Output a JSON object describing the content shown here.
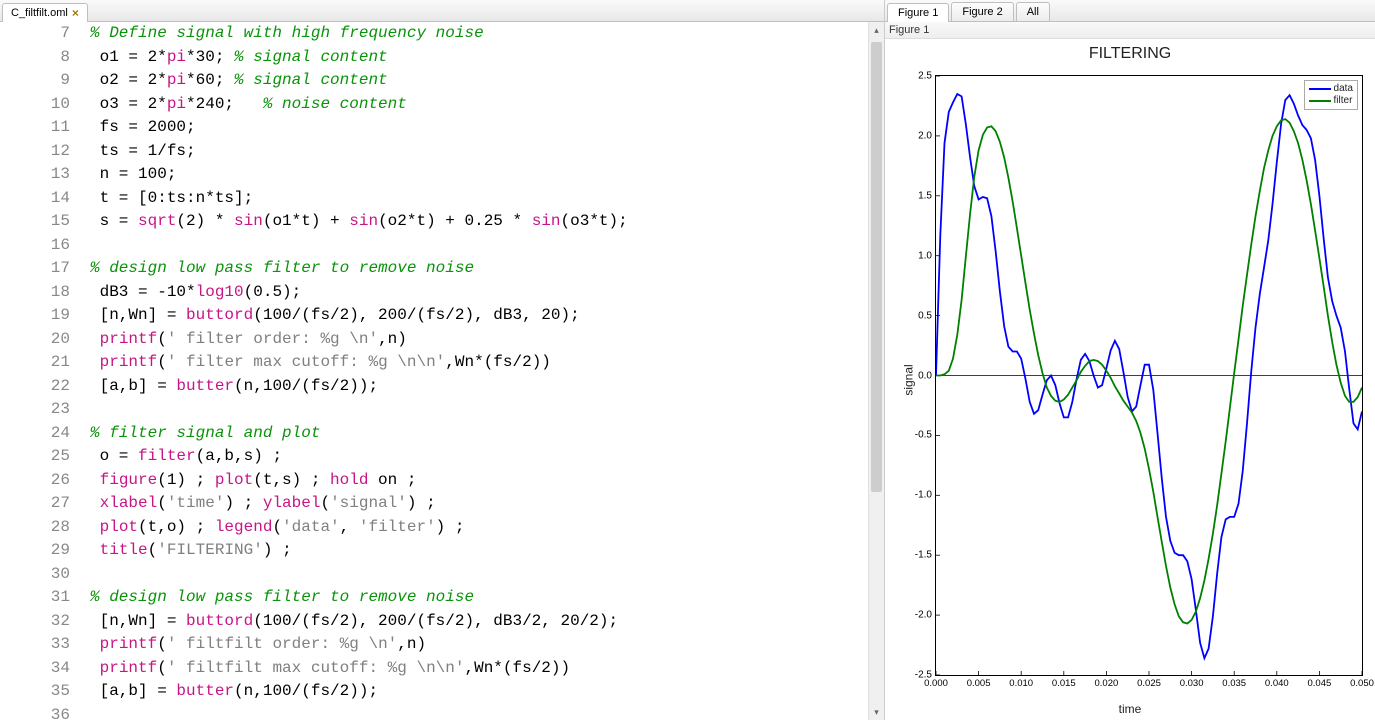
{
  "editor": {
    "tab_label": "C_filtfilt.oml",
    "lines": [
      {
        "n": 7,
        "tokens": [
          {
            "t": "% Define signal with high frequency noise",
            "c": "comment"
          }
        ]
      },
      {
        "n": 8,
        "tokens": [
          {
            "t": " o1 = 2*",
            "c": "default"
          },
          {
            "t": "pi",
            "c": "func"
          },
          {
            "t": "*30; ",
            "c": "default"
          },
          {
            "t": "% signal content",
            "c": "comment"
          }
        ]
      },
      {
        "n": 9,
        "tokens": [
          {
            "t": " o2 = 2*",
            "c": "default"
          },
          {
            "t": "pi",
            "c": "func"
          },
          {
            "t": "*60; ",
            "c": "default"
          },
          {
            "t": "% signal content",
            "c": "comment"
          }
        ]
      },
      {
        "n": 10,
        "tokens": [
          {
            "t": " o3 = 2*",
            "c": "default"
          },
          {
            "t": "pi",
            "c": "func"
          },
          {
            "t": "*240;   ",
            "c": "default"
          },
          {
            "t": "% noise content",
            "c": "comment"
          }
        ]
      },
      {
        "n": 11,
        "tokens": [
          {
            "t": " fs = 2000;",
            "c": "default"
          }
        ]
      },
      {
        "n": 12,
        "tokens": [
          {
            "t": " ts = 1/fs;",
            "c": "default"
          }
        ]
      },
      {
        "n": 13,
        "tokens": [
          {
            "t": " n = 100;",
            "c": "default"
          }
        ]
      },
      {
        "n": 14,
        "tokens": [
          {
            "t": " t = [0:ts:n*ts];",
            "c": "default"
          }
        ]
      },
      {
        "n": 15,
        "tokens": [
          {
            "t": " s = ",
            "c": "default"
          },
          {
            "t": "sqrt",
            "c": "func"
          },
          {
            "t": "(2) * ",
            "c": "default"
          },
          {
            "t": "sin",
            "c": "func"
          },
          {
            "t": "(o1*t) + ",
            "c": "default"
          },
          {
            "t": "sin",
            "c": "func"
          },
          {
            "t": "(o2*t) + 0.25 * ",
            "c": "default"
          },
          {
            "t": "sin",
            "c": "func"
          },
          {
            "t": "(o3*t);",
            "c": "default"
          }
        ]
      },
      {
        "n": 16,
        "tokens": []
      },
      {
        "n": 17,
        "tokens": [
          {
            "t": "% design low pass filter to remove noise",
            "c": "comment"
          }
        ]
      },
      {
        "n": 18,
        "tokens": [
          {
            "t": " dB3 = -10*",
            "c": "default"
          },
          {
            "t": "log10",
            "c": "func"
          },
          {
            "t": "(0.5);",
            "c": "default"
          }
        ]
      },
      {
        "n": 19,
        "tokens": [
          {
            "t": " [n,Wn] = ",
            "c": "default"
          },
          {
            "t": "buttord",
            "c": "func"
          },
          {
            "t": "(100/(fs/2), 200/(fs/2), dB3, 20);",
            "c": "default"
          }
        ]
      },
      {
        "n": 20,
        "tokens": [
          {
            "t": " ",
            "c": "default"
          },
          {
            "t": "printf",
            "c": "func"
          },
          {
            "t": "(",
            "c": "default"
          },
          {
            "t": "' filter order: %g \\n'",
            "c": "string"
          },
          {
            "t": ",n)",
            "c": "default"
          }
        ]
      },
      {
        "n": 21,
        "tokens": [
          {
            "t": " ",
            "c": "default"
          },
          {
            "t": "printf",
            "c": "func"
          },
          {
            "t": "(",
            "c": "default"
          },
          {
            "t": "' filter max cutoff: %g \\n\\n'",
            "c": "string"
          },
          {
            "t": ",Wn*(fs/2))",
            "c": "default"
          }
        ]
      },
      {
        "n": 22,
        "tokens": [
          {
            "t": " [a,b] = ",
            "c": "default"
          },
          {
            "t": "butter",
            "c": "func"
          },
          {
            "t": "(n,100/(fs/2));",
            "c": "default"
          }
        ]
      },
      {
        "n": 23,
        "tokens": []
      },
      {
        "n": 24,
        "tokens": [
          {
            "t": "% filter signal and plot",
            "c": "comment"
          }
        ]
      },
      {
        "n": 25,
        "tokens": [
          {
            "t": " o = ",
            "c": "default"
          },
          {
            "t": "filter",
            "c": "func"
          },
          {
            "t": "(a,b,s) ;",
            "c": "default"
          }
        ]
      },
      {
        "n": 26,
        "tokens": [
          {
            "t": " ",
            "c": "default"
          },
          {
            "t": "figure",
            "c": "func"
          },
          {
            "t": "(1) ; ",
            "c": "default"
          },
          {
            "t": "plot",
            "c": "func"
          },
          {
            "t": "(t,s) ; ",
            "c": "default"
          },
          {
            "t": "hold",
            "c": "func"
          },
          {
            "t": " on ;",
            "c": "default"
          }
        ]
      },
      {
        "n": 27,
        "tokens": [
          {
            "t": " ",
            "c": "default"
          },
          {
            "t": "xlabel",
            "c": "func"
          },
          {
            "t": "(",
            "c": "default"
          },
          {
            "t": "'time'",
            "c": "string"
          },
          {
            "t": ") ; ",
            "c": "default"
          },
          {
            "t": "ylabel",
            "c": "func"
          },
          {
            "t": "(",
            "c": "default"
          },
          {
            "t": "'signal'",
            "c": "string"
          },
          {
            "t": ") ;",
            "c": "default"
          }
        ]
      },
      {
        "n": 28,
        "tokens": [
          {
            "t": " ",
            "c": "default"
          },
          {
            "t": "plot",
            "c": "func"
          },
          {
            "t": "(t,o) ; ",
            "c": "default"
          },
          {
            "t": "legend",
            "c": "func"
          },
          {
            "t": "(",
            "c": "default"
          },
          {
            "t": "'data'",
            "c": "string"
          },
          {
            "t": ", ",
            "c": "default"
          },
          {
            "t": "'filter'",
            "c": "string"
          },
          {
            "t": ") ;",
            "c": "default"
          }
        ]
      },
      {
        "n": 29,
        "tokens": [
          {
            "t": " ",
            "c": "default"
          },
          {
            "t": "title",
            "c": "func"
          },
          {
            "t": "(",
            "c": "default"
          },
          {
            "t": "'FILTERING'",
            "c": "string"
          },
          {
            "t": ") ;",
            "c": "default"
          }
        ]
      },
      {
        "n": 30,
        "tokens": []
      },
      {
        "n": 31,
        "tokens": [
          {
            "t": "% design low pass filter to remove noise",
            "c": "comment"
          }
        ]
      },
      {
        "n": 32,
        "tokens": [
          {
            "t": " [n,Wn] = ",
            "c": "default"
          },
          {
            "t": "buttord",
            "c": "func"
          },
          {
            "t": "(100/(fs/2), 200/(fs/2), dB3/2, 20/2);",
            "c": "default"
          }
        ]
      },
      {
        "n": 33,
        "tokens": [
          {
            "t": " ",
            "c": "default"
          },
          {
            "t": "printf",
            "c": "func"
          },
          {
            "t": "(",
            "c": "default"
          },
          {
            "t": "' filtfilt order: %g \\n'",
            "c": "string"
          },
          {
            "t": ",n)",
            "c": "default"
          }
        ]
      },
      {
        "n": 34,
        "tokens": [
          {
            "t": " ",
            "c": "default"
          },
          {
            "t": "printf",
            "c": "func"
          },
          {
            "t": "(",
            "c": "default"
          },
          {
            "t": "' filtfilt max cutoff: %g \\n\\n'",
            "c": "string"
          },
          {
            "t": ",Wn*(fs/2))",
            "c": "default"
          }
        ]
      },
      {
        "n": 35,
        "tokens": [
          {
            "t": " [a,b] = ",
            "c": "default"
          },
          {
            "t": "butter",
            "c": "func"
          },
          {
            "t": "(n,100/(fs/2));",
            "c": "default"
          }
        ]
      },
      {
        "n": 36,
        "tokens": []
      }
    ]
  },
  "figure_pane": {
    "tabs": [
      "Figure 1",
      "Figure 2",
      "All"
    ],
    "active_tab": 0,
    "subtitle": "Figure 1"
  },
  "chart_data": {
    "type": "line",
    "title": "FILTERING",
    "xlabel": "time",
    "ylabel": "signal",
    "xlim": [
      0.0,
      0.05
    ],
    "ylim": [
      -2.5,
      2.5
    ],
    "x_ticks": [
      "0.000",
      "0.005",
      "0.010",
      "0.015",
      "0.020",
      "0.025",
      "0.030",
      "0.035",
      "0.040",
      "0.045",
      "0.050"
    ],
    "y_ticks": [
      "2.5",
      "2.0",
      "1.5",
      "1.0",
      "0.5",
      "0.0",
      "-0.5",
      "-1.0",
      "-1.5",
      "-2.0",
      "-2.5"
    ],
    "legend": [
      "data",
      "filter"
    ],
    "colors": {
      "data": "#0000ff",
      "filter": "#008000"
    },
    "series": [
      {
        "name": "data",
        "x_step": 0.0005,
        "y": [
          0.0,
          1.17,
          1.94,
          2.2,
          2.28,
          2.35,
          2.33,
          2.1,
          1.82,
          1.58,
          1.47,
          1.49,
          1.48,
          1.33,
          1.04,
          0.7,
          0.41,
          0.24,
          0.2,
          0.2,
          0.14,
          -0.03,
          -0.22,
          -0.32,
          -0.29,
          -0.16,
          -0.04,
          0.0,
          -0.08,
          -0.23,
          -0.35,
          -0.35,
          -0.22,
          -0.03,
          0.13,
          0.18,
          0.12,
          0.0,
          -0.1,
          -0.08,
          0.06,
          0.21,
          0.29,
          0.22,
          0.03,
          -0.18,
          -0.3,
          -0.26,
          -0.08,
          0.09,
          0.09,
          -0.12,
          -0.48,
          -0.86,
          -1.18,
          -1.38,
          -1.48,
          -1.5,
          -1.5,
          -1.55,
          -1.7,
          -1.96,
          -2.23,
          -2.36,
          -2.28,
          -2.01,
          -1.65,
          -1.35,
          -1.2,
          -1.18,
          -1.18,
          -1.07,
          -0.8,
          -0.4,
          0.03,
          0.4,
          0.68,
          0.9,
          1.13,
          1.43,
          1.78,
          2.1,
          2.3,
          2.34,
          2.27,
          2.17,
          2.09,
          2.05,
          1.98,
          1.8,
          1.5,
          1.14,
          0.82,
          0.62,
          0.5,
          0.4,
          0.2,
          -0.11,
          -0.4,
          -0.45,
          -0.3
        ]
      },
      {
        "name": "filter",
        "x_step": 0.0005,
        "y": [
          0.0,
          0.0,
          0.01,
          0.04,
          0.14,
          0.34,
          0.63,
          0.99,
          1.35,
          1.66,
          1.88,
          2.01,
          2.07,
          2.08,
          2.04,
          1.95,
          1.82,
          1.65,
          1.45,
          1.23,
          1.0,
          0.77,
          0.55,
          0.35,
          0.17,
          0.02,
          -0.1,
          -0.17,
          -0.21,
          -0.22,
          -0.2,
          -0.16,
          -0.1,
          -0.04,
          0.03,
          0.08,
          0.12,
          0.13,
          0.12,
          0.09,
          0.04,
          -0.02,
          -0.09,
          -0.15,
          -0.21,
          -0.26,
          -0.31,
          -0.38,
          -0.48,
          -0.61,
          -0.78,
          -0.97,
          -1.18,
          -1.39,
          -1.59,
          -1.77,
          -1.91,
          -2.01,
          -2.06,
          -2.07,
          -2.04,
          -1.97,
          -1.86,
          -1.71,
          -1.53,
          -1.32,
          -1.08,
          -0.82,
          -0.55,
          -0.27,
          0.02,
          0.3,
          0.58,
          0.84,
          1.09,
          1.33,
          1.54,
          1.73,
          1.88,
          2.0,
          2.08,
          2.13,
          2.14,
          2.11,
          2.04,
          1.94,
          1.8,
          1.63,
          1.43,
          1.21,
          0.98,
          0.74,
          0.5,
          0.28,
          0.09,
          -0.06,
          -0.17,
          -0.22,
          -0.22,
          -0.18,
          -0.1
        ]
      }
    ]
  }
}
